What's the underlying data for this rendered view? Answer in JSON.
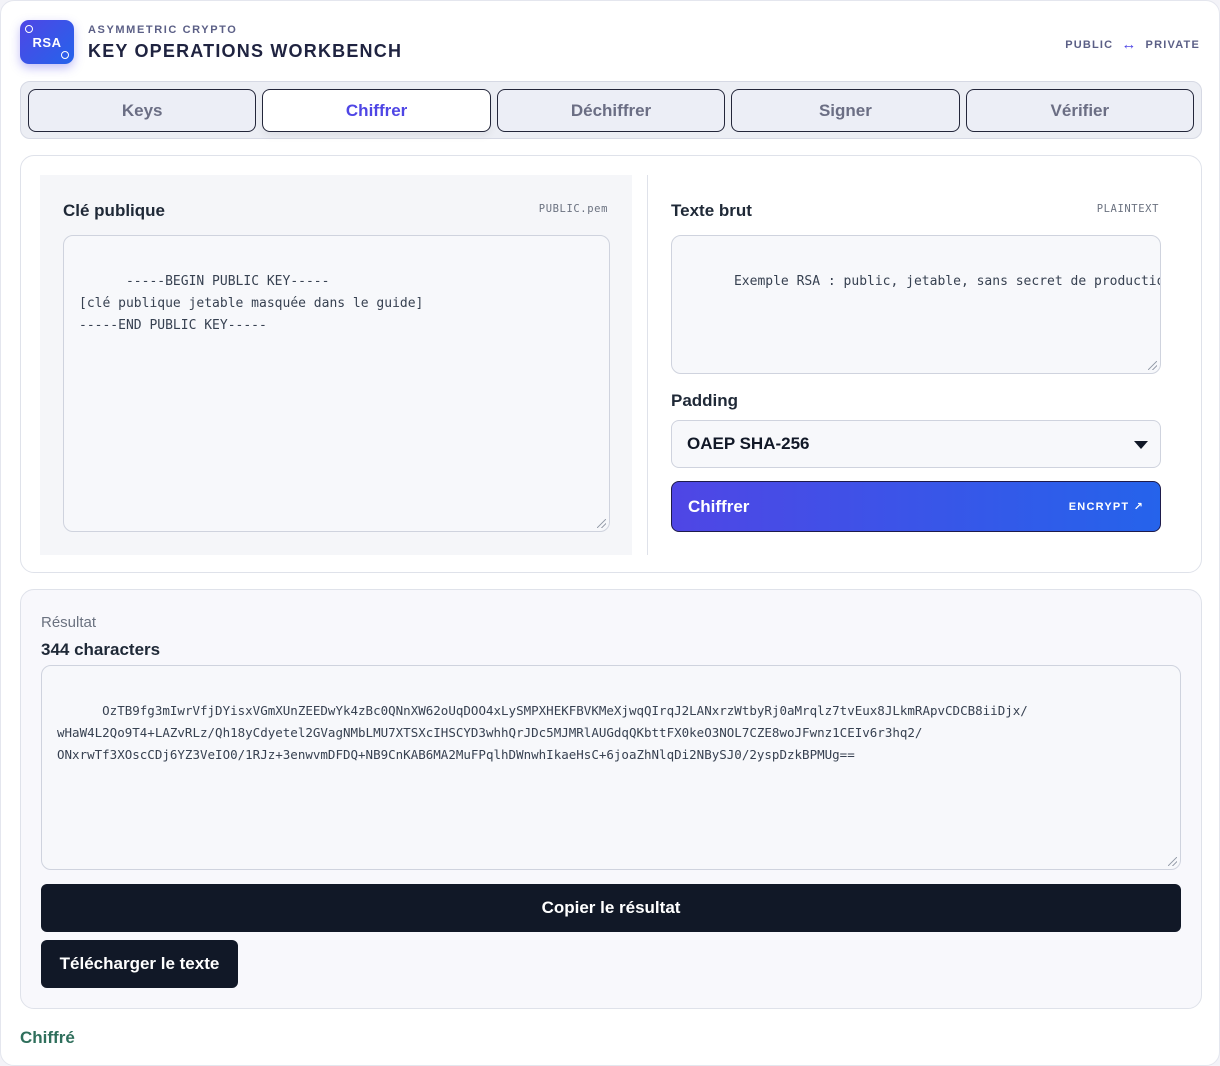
{
  "header": {
    "logo_text": "RSA",
    "eyebrow": "ASYMMETRIC CRYPTO",
    "title": "KEY OPERATIONS WORKBENCH",
    "mode_left": "PUBLIC",
    "mode_arrow": "↔",
    "mode_right": "PRIVATE"
  },
  "tabs": [
    {
      "label": "Keys",
      "active": false
    },
    {
      "label": "Chiffrer",
      "active": true
    },
    {
      "label": "Déchiffrer",
      "active": false
    },
    {
      "label": "Signer",
      "active": false
    },
    {
      "label": "Vérifier",
      "active": false
    }
  ],
  "public_key": {
    "label": "Clé publique",
    "tag": "PUBLIC.pem",
    "value": "-----BEGIN PUBLIC KEY-----\n[clé publique jetable masquée dans le guide]\n-----END PUBLIC KEY-----"
  },
  "plaintext": {
    "label": "Texte brut",
    "tag": "PLAINTEXT",
    "value": "Exemple RSA : public, jetable, sans secret de production."
  },
  "padding": {
    "label": "Padding",
    "selected": "OAEP SHA-256"
  },
  "encrypt_button": {
    "label": "Chiffrer",
    "hint": "ENCRYPT ↗"
  },
  "result": {
    "caption": "Résultat",
    "count": "344 characters",
    "value": "OzTB9fg3mIwrVfjDYisxVGmXUnZEEDwYk4zBc0QNnXW62oUqDOO4xLySMPXHEKFBVKMeXjwqQIrqJ2LANxrzWtbyRj0aMrqlz7tvEux8JLkmRApvCDCB8iiDjx/\nwHaW4L2Qo9T4+LAZvRLz/Qh18yCdyetel2GVagNMbLMU7XTSXcIHSCYD3whhQrJDc5MJMRlAUGdqQKbttFX0keO3NOL7CZE8woJFwnz1CEIv6r3hq2/\nONxrwTf3XOscCDj6YZ3VeIO0/1RJz+3enwvmDFDQ+NB9CnKAB6MA2MuFPqlhDWnwhIkaeHsC+6joaZhNlqDi2NBySJ0/2yspDzkBPMUg==",
    "copy_label": "Copier le résultat",
    "download_label": "Télécharger le texte"
  },
  "status": "Chiffré"
}
